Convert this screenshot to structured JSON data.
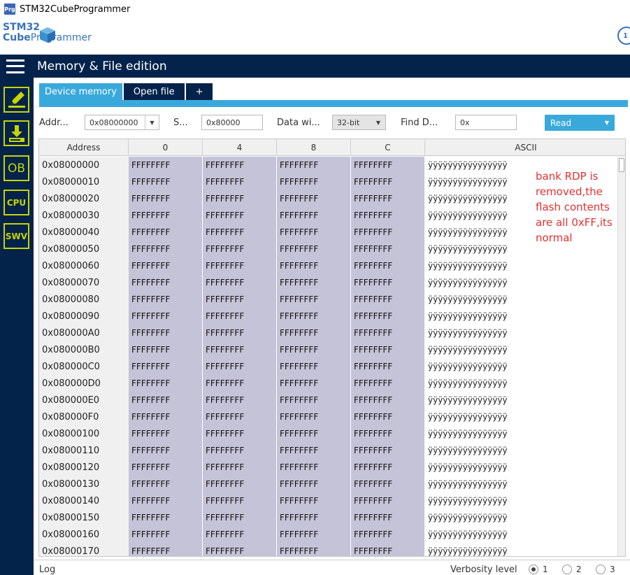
{
  "app": {
    "icon_text": "Prg",
    "title": "STM32CubeProgrammer",
    "logo_line1": "STM32",
    "logo_line2_bold": "Cube",
    "logo_line2": "Programmer",
    "badge_text": "1"
  },
  "header": {
    "title": "Memory & File edition"
  },
  "sidebar": {
    "items": [
      {
        "icon": "edit-icon"
      },
      {
        "icon": "download-icon"
      },
      {
        "label": "OB"
      },
      {
        "label": "CPU"
      },
      {
        "label": "SWV"
      }
    ]
  },
  "tabs": [
    {
      "label": "Device memory"
    },
    {
      "label": "Open file"
    },
    {
      "label": "+"
    }
  ],
  "toolbar": {
    "address_label": "Addr...",
    "address_value": "0x08000000",
    "size_label": "S...",
    "size_value": "0x80000",
    "data_width_label": "Data wi...",
    "data_width_value": "32-bit",
    "find_label": "Find D...",
    "find_value": "0x",
    "read_label": "Read"
  },
  "table": {
    "headers": [
      "Address",
      "0",
      "4",
      "8",
      "C",
      "ASCII"
    ],
    "rows": [
      {
        "addr": "0x08000000",
        "c0": "FFFFFFFF",
        "c4": "FFFFFFFF",
        "c8": "FFFFFFFF",
        "cC": "FFFFFFFF",
        "ascii": "ÿÿÿÿÿÿÿÿÿÿÿÿÿÿÿÿ"
      },
      {
        "addr": "0x08000010",
        "c0": "FFFFFFFF",
        "c4": "FFFFFFFF",
        "c8": "FFFFFFFF",
        "cC": "FFFFFFFF",
        "ascii": "ÿÿÿÿÿÿÿÿÿÿÿÿÿÿÿÿ"
      },
      {
        "addr": "0x08000020",
        "c0": "FFFFFFFF",
        "c4": "FFFFFFFF",
        "c8": "FFFFFFFF",
        "cC": "FFFFFFFF",
        "ascii": "ÿÿÿÿÿÿÿÿÿÿÿÿÿÿÿÿ"
      },
      {
        "addr": "0x08000030",
        "c0": "FFFFFFFF",
        "c4": "FFFFFFFF",
        "c8": "FFFFFFFF",
        "cC": "FFFFFFFF",
        "ascii": "ÿÿÿÿÿÿÿÿÿÿÿÿÿÿÿÿ"
      },
      {
        "addr": "0x08000040",
        "c0": "FFFFFFFF",
        "c4": "FFFFFFFF",
        "c8": "FFFFFFFF",
        "cC": "FFFFFFFF",
        "ascii": "ÿÿÿÿÿÿÿÿÿÿÿÿÿÿÿÿ"
      },
      {
        "addr": "0x08000050",
        "c0": "FFFFFFFF",
        "c4": "FFFFFFFF",
        "c8": "FFFFFFFF",
        "cC": "FFFFFFFF",
        "ascii": "ÿÿÿÿÿÿÿÿÿÿÿÿÿÿÿÿ"
      },
      {
        "addr": "0x08000060",
        "c0": "FFFFFFFF",
        "c4": "FFFFFFFF",
        "c8": "FFFFFFFF",
        "cC": "FFFFFFFF",
        "ascii": "ÿÿÿÿÿÿÿÿÿÿÿÿÿÿÿÿ"
      },
      {
        "addr": "0x08000070",
        "c0": "FFFFFFFF",
        "c4": "FFFFFFFF",
        "c8": "FFFFFFFF",
        "cC": "FFFFFFFF",
        "ascii": "ÿÿÿÿÿÿÿÿÿÿÿÿÿÿÿÿ"
      },
      {
        "addr": "0x08000080",
        "c0": "FFFFFFFF",
        "c4": "FFFFFFFF",
        "c8": "FFFFFFFF",
        "cC": "FFFFFFFF",
        "ascii": "ÿÿÿÿÿÿÿÿÿÿÿÿÿÿÿÿ"
      },
      {
        "addr": "0x08000090",
        "c0": "FFFFFFFF",
        "c4": "FFFFFFFF",
        "c8": "FFFFFFFF",
        "cC": "FFFFFFFF",
        "ascii": "ÿÿÿÿÿÿÿÿÿÿÿÿÿÿÿÿ"
      },
      {
        "addr": "0x080000A0",
        "c0": "FFFFFFFF",
        "c4": "FFFFFFFF",
        "c8": "FFFFFFFF",
        "cC": "FFFFFFFF",
        "ascii": "ÿÿÿÿÿÿÿÿÿÿÿÿÿÿÿÿ"
      },
      {
        "addr": "0x080000B0",
        "c0": "FFFFFFFF",
        "c4": "FFFFFFFF",
        "c8": "FFFFFFFF",
        "cC": "FFFFFFFF",
        "ascii": "ÿÿÿÿÿÿÿÿÿÿÿÿÿÿÿÿ"
      },
      {
        "addr": "0x080000C0",
        "c0": "FFFFFFFF",
        "c4": "FFFFFFFF",
        "c8": "FFFFFFFF",
        "cC": "FFFFFFFF",
        "ascii": "ÿÿÿÿÿÿÿÿÿÿÿÿÿÿÿÿ"
      },
      {
        "addr": "0x080000D0",
        "c0": "FFFFFFFF",
        "c4": "FFFFFFFF",
        "c8": "FFFFFFFF",
        "cC": "FFFFFFFF",
        "ascii": "ÿÿÿÿÿÿÿÿÿÿÿÿÿÿÿÿ"
      },
      {
        "addr": "0x080000E0",
        "c0": "FFFFFFFF",
        "c4": "FFFFFFFF",
        "c8": "FFFFFFFF",
        "cC": "FFFFFFFF",
        "ascii": "ÿÿÿÿÿÿÿÿÿÿÿÿÿÿÿÿ"
      },
      {
        "addr": "0x080000F0",
        "c0": "FFFFFFFF",
        "c4": "FFFFFFFF",
        "c8": "FFFFFFFF",
        "cC": "FFFFFFFF",
        "ascii": "ÿÿÿÿÿÿÿÿÿÿÿÿÿÿÿÿ"
      },
      {
        "addr": "0x08000100",
        "c0": "FFFFFFFF",
        "c4": "FFFFFFFF",
        "c8": "FFFFFFFF",
        "cC": "FFFFFFFF",
        "ascii": "ÿÿÿÿÿÿÿÿÿÿÿÿÿÿÿÿ"
      },
      {
        "addr": "0x08000110",
        "c0": "FFFFFFFF",
        "c4": "FFFFFFFF",
        "c8": "FFFFFFFF",
        "cC": "FFFFFFFF",
        "ascii": "ÿÿÿÿÿÿÿÿÿÿÿÿÿÿÿÿ"
      },
      {
        "addr": "0x08000120",
        "c0": "FFFFFFFF",
        "c4": "FFFFFFFF",
        "c8": "FFFFFFFF",
        "cC": "FFFFFFFF",
        "ascii": "ÿÿÿÿÿÿÿÿÿÿÿÿÿÿÿÿ"
      },
      {
        "addr": "0x08000130",
        "c0": "FFFFFFFF",
        "c4": "FFFFFFFF",
        "c8": "FFFFFFFF",
        "cC": "FFFFFFFF",
        "ascii": "ÿÿÿÿÿÿÿÿÿÿÿÿÿÿÿÿ"
      },
      {
        "addr": "0x08000140",
        "c0": "FFFFFFFF",
        "c4": "FFFFFFFF",
        "c8": "FFFFFFFF",
        "cC": "FFFFFFFF",
        "ascii": "ÿÿÿÿÿÿÿÿÿÿÿÿÿÿÿÿ"
      },
      {
        "addr": "0x08000150",
        "c0": "FFFFFFFF",
        "c4": "FFFFFFFF",
        "c8": "FFFFFFFF",
        "cC": "FFFFFFFF",
        "ascii": "ÿÿÿÿÿÿÿÿÿÿÿÿÿÿÿÿ"
      },
      {
        "addr": "0x08000160",
        "c0": "FFFFFFFF",
        "c4": "FFFFFFFF",
        "c8": "FFFFFFFF",
        "cC": "FFFFFFFF",
        "ascii": "ÿÿÿÿÿÿÿÿÿÿÿÿÿÿÿÿ"
      },
      {
        "addr": "0x08000170",
        "c0": "FFFFFFFF",
        "c4": "FFFFFFFF",
        "c8": "FFFFFFFF",
        "cC": "FFFFFFFF",
        "ascii": "ÿÿÿÿÿÿÿÿÿÿÿÿÿÿÿÿ"
      }
    ]
  },
  "annotation": {
    "text": "bank RDP is removed,the flash contents are all 0xFF,its normal",
    "color": "#e53030"
  },
  "log": {
    "label": "Log",
    "verbosity_label": "Verbosity level",
    "levels": [
      "1",
      "2",
      "3"
    ],
    "selected_level": "1"
  },
  "colors": {
    "navy": "#03234b",
    "accent": "#39a9dc",
    "sidebar_icon": "#c8d400",
    "data_cell": "#c5c3d8"
  }
}
